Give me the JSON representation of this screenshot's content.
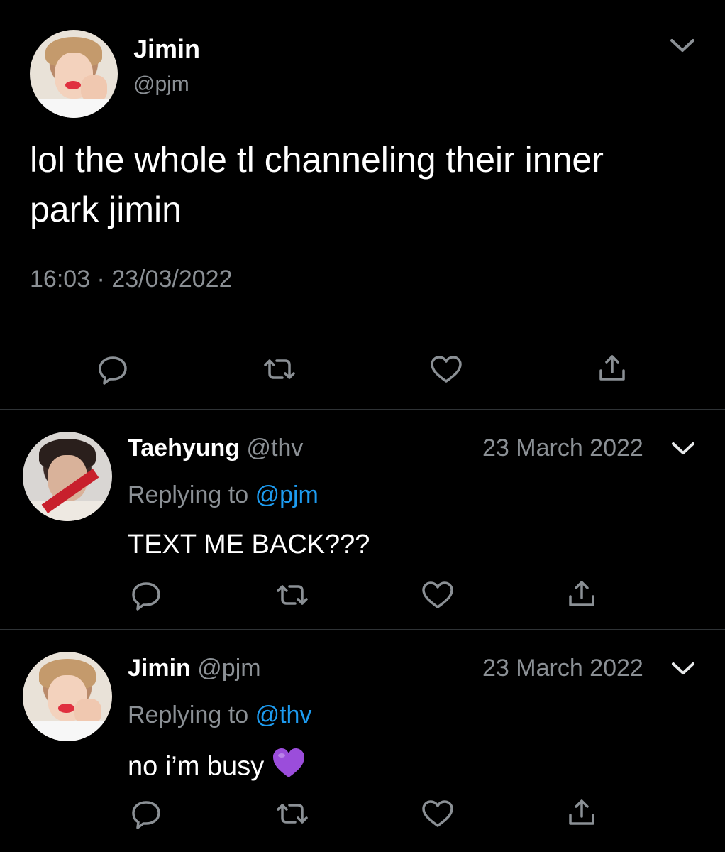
{
  "main_tweet": {
    "display_name": "Jimin",
    "handle": "@pjm",
    "text_line1": "lol the whole tl channeling their inner",
    "text_line2": "park jimin",
    "time": "16:03",
    "separator": "·",
    "date": "23/03/2022"
  },
  "replies": [
    {
      "display_name": "Taehyung",
      "handle": "@thv",
      "date": "23 March 2022",
      "replying_prefix": "Replying to",
      "replying_to": "@pjm",
      "text": "TEXT ME BACK???"
    },
    {
      "display_name": "Jimin",
      "handle": "@pjm",
      "date": "23 March 2022",
      "replying_prefix": "Replying to",
      "replying_to": "@thv",
      "text": "no i’m busy",
      "emoji": "purple-heart-icon"
    }
  ],
  "icons": {
    "reply": "reply-icon",
    "retweet": "retweet-icon",
    "like": "heart-icon",
    "share": "share-icon",
    "more": "chevron-down-icon"
  },
  "colors": {
    "background": "#000000",
    "link": "#1d9bf0",
    "muted": "#8b9095",
    "divider": "#2f3336",
    "emoji_purple": "#9b4ddb"
  }
}
